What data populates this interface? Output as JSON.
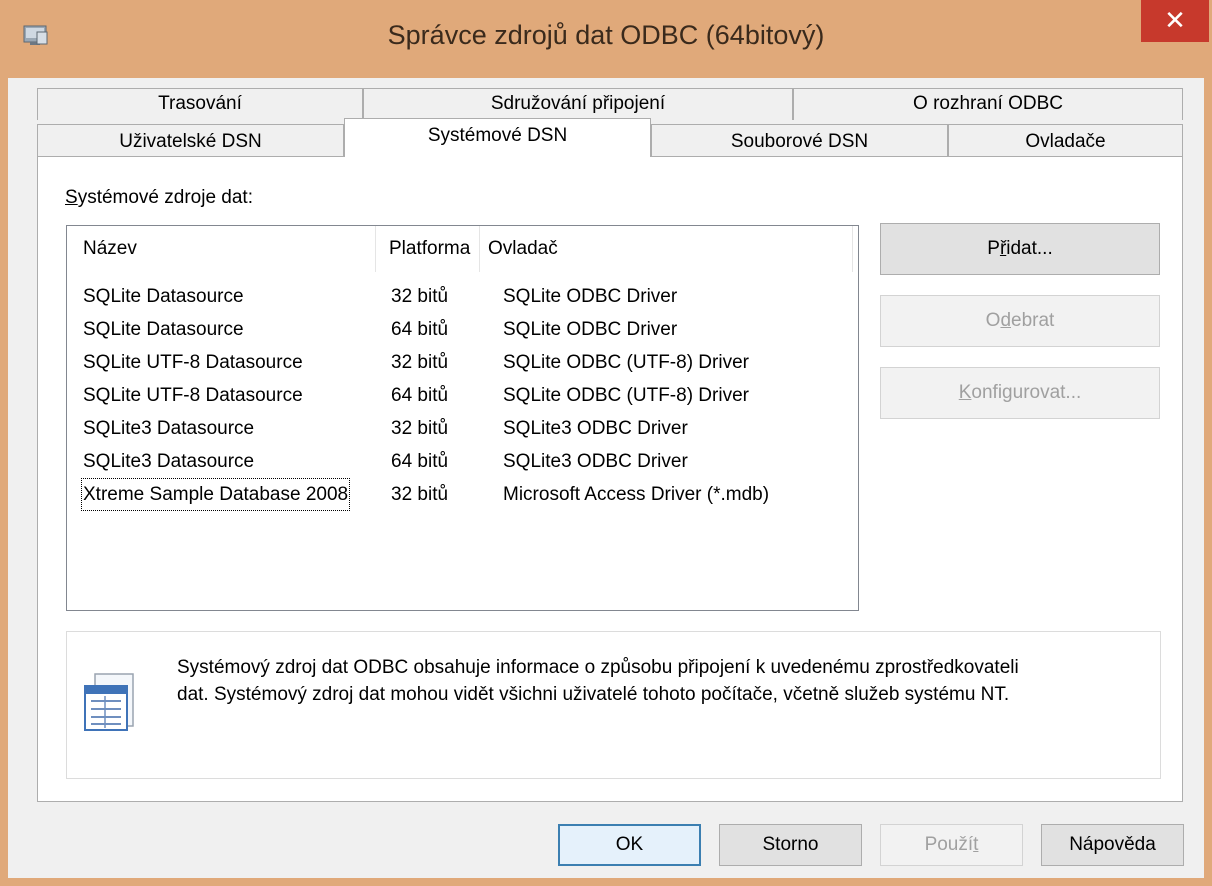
{
  "window": {
    "title": "Správce zdrojů dat ODBC (64bitový)",
    "close_glyph": "✕"
  },
  "tabs_back_row": [
    "Trasování",
    "Sdružování připojení",
    "O rozhraní ODBC"
  ],
  "tabs_front_row": [
    "Uživatelské DSN",
    "Systémové DSN",
    "Souborové DSN",
    "Ovladače"
  ],
  "active_tab": "Systémové DSN",
  "list": {
    "label": "Systémové zdroje dat:",
    "label_accel": "S",
    "label_rest": "ystémové zdroje dat:",
    "columns": [
      "Název",
      "Platforma",
      "Ovladač"
    ],
    "rows": [
      {
        "name": "SQLite Datasource",
        "platform": "32 bitů",
        "driver": "SQLite ODBC Driver"
      },
      {
        "name": "SQLite Datasource",
        "platform": "64 bitů",
        "driver": "SQLite ODBC Driver"
      },
      {
        "name": "SQLite UTF-8 Datasource",
        "platform": "32 bitů",
        "driver": "SQLite ODBC (UTF-8) Driver"
      },
      {
        "name": "SQLite UTF-8 Datasource",
        "platform": "64 bitů",
        "driver": "SQLite ODBC (UTF-8) Driver"
      },
      {
        "name": "SQLite3 Datasource",
        "platform": "32 bitů",
        "driver": "SQLite3 ODBC Driver"
      },
      {
        "name": "SQLite3 Datasource",
        "platform": "64 bitů",
        "driver": "SQLite3 ODBC Driver"
      },
      {
        "name": "Xtreme Sample Database 2008",
        "platform": "32 bitů",
        "driver": "Microsoft Access Driver (*.mdb)"
      }
    ]
  },
  "side_buttons": {
    "add": {
      "label": "Přidat...",
      "accel": "ř",
      "pre": "P",
      "post": "idat..."
    },
    "remove": {
      "label": "Odebrat",
      "accel": "d",
      "pre": "O",
      "post": "ebrat"
    },
    "configure": {
      "label": "Konfigurovat...",
      "accel": "K",
      "pre": "",
      "post": "onfigurovat..."
    }
  },
  "info": {
    "text_line1": "Systémový zdroj dat ODBC obsahuje informace o způsobu připojení k uvedenému zprostředkovateli",
    "text_line2": "dat. Systémový zdroj dat mohou vidět všichni uživatelé tohoto počítače, včetně služeb systému NT.",
    "icon": "data-source-icon"
  },
  "bottom_buttons": {
    "ok": "OK",
    "cancel": "Storno",
    "apply": {
      "pre": "Použí",
      "accel": "t"
    },
    "help": "Nápověda"
  }
}
